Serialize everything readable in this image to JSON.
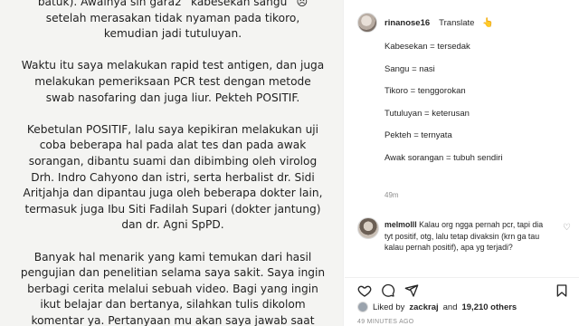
{
  "post_text": [
    "batuk). Awalnya sih gara2 “kabesekan sangu” 😣",
    "setelah merasakan tidak nyaman pada tikoro,",
    "kemudian jadi tutuluyan.",
    "",
    "Waktu itu saya melakukan rapid test antigen, dan juga",
    "melakukan pemeriksaan PCR test dengan metode",
    "swab nasofaring dan juga liur. Pekteh POSITIF.",
    "",
    "Kebetulan POSITIF, lalu saya kepikiran melakukan uji",
    "coba beberapa hal pada alat tes dan pada awak",
    "sorangan, dibantu suami dan dibimbing oleh virolog",
    "Drh. Indro Cahyono dan istri, serta herbalist dr. Sidi",
    "Aritjahja dan dipantau juga oleh beberapa dokter lain,",
    "termasuk juga Ibu Siti Fadilah Supari (dokter jantung)",
    "dan dr. Agni SpPD.",
    "",
    "Banyak hal menarik yang kami temukan dari hasil",
    "pengujian dan penelitian selama saya sakit. Saya ingin",
    "berbagi cerita melalui sebuah video. Bagi yang ingin",
    "ikut belajar dan bertanya, silahkan tulis dikolom",
    "komentar ya. Pertanyaan mu akan saya jawab saat"
  ],
  "author": {
    "username": "rinanose16",
    "translate_label": "Translate",
    "hand_emoji": "👆"
  },
  "caption_lines": [
    "Kabesekan = tersedak",
    "Sangu = nasi",
    "Tikoro = tenggorokan",
    "Tutuluyan = keterusan",
    "Pekteh = ternyata",
    "Awak sorangan = tubuh sendiri"
  ],
  "caption_time": "49m",
  "comment": {
    "username": "melmolll",
    "text": "Kalau org ngga pernah pcr, tapi dia tyt positif, otg, lalu tetap divaksin (krn ga tau kalau pernah positif), apa yg terjadi?"
  },
  "likes": {
    "text_prefix": "Liked by",
    "user": "zackraj",
    "text_mid": "and",
    "count": "19,210 others"
  },
  "post_time": "49 MINUTES AGO",
  "icons": {
    "heart": "heart-icon",
    "comment": "comment-icon",
    "share": "share-icon",
    "bookmark": "bookmark-icon"
  }
}
